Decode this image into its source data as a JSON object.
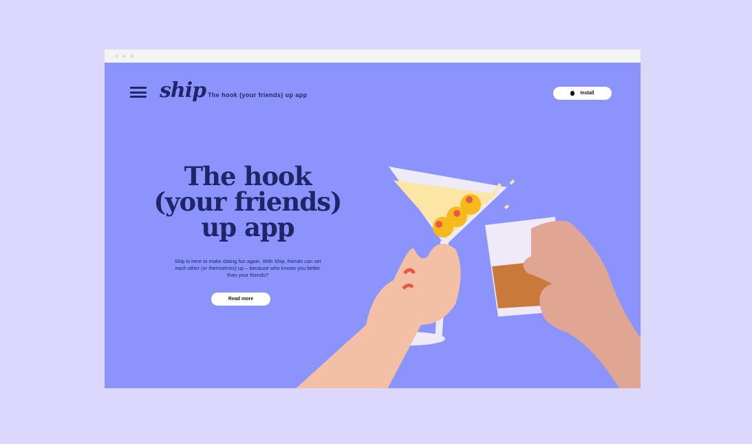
{
  "header": {
    "logo": "ship",
    "tagline": "The hook (your friends) up app",
    "install_label": "Install"
  },
  "hero": {
    "title": "The hook (your friends) up app",
    "description": "Ship is here to make dating fun again. With Ship, friends can set each other (or themselves) up – because who knows you better than your friends?",
    "read_more_label": "Read more"
  },
  "colors": {
    "background": "#8b93fd",
    "text": "#1f2566",
    "page": "#dcd8fb"
  }
}
